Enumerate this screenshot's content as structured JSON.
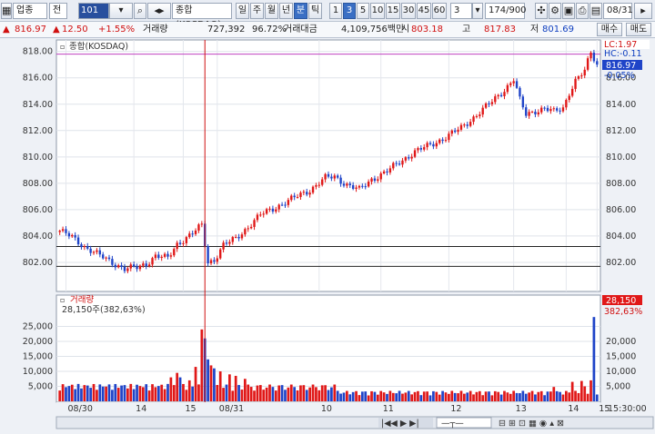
{
  "toolbar": {
    "market_select": "업종",
    "market_type": "전",
    "code": "101",
    "search_icon": "search-icon",
    "prev_next_icon": "nav-arrows-icon",
    "index_name": "종합(KOSDAQ)",
    "periods": [
      "일",
      "주",
      "월",
      "년",
      "분",
      "틱"
    ],
    "active_period": "분",
    "minutes": [
      "1",
      "3",
      "5",
      "10",
      "15",
      "30",
      "45",
      "60"
    ],
    "active_minute": "3",
    "interval_select": "3",
    "count": "174/900",
    "date": "08/31"
  },
  "quote": {
    "price": "816.97",
    "change": "12.50",
    "change_pct": "+1.55%",
    "volume_label": "거래량",
    "volume": "727,392",
    "volume_ratio": "96.72%",
    "amount_label": "거래대금",
    "amount": "4,109,756백만",
    "open_label": "시",
    "open": "803.18",
    "high_label": "고",
    "high": "817.83",
    "low_label": "저",
    "low": "801.69",
    "buy_label": "매수",
    "sell_label": "매도"
  },
  "colors": {
    "up": "#e01818",
    "down": "#1f44c8",
    "cursor": "#d01010"
  },
  "chart_data": [
    {
      "type": "candlestick",
      "title": "종합(KOSDAQ)",
      "ylim": [
        800.0,
        818.6
      ],
      "yticks": [
        "818.00",
        "816.00",
        "814.00",
        "812.00",
        "810.00",
        "808.00",
        "806.00",
        "804.00",
        "802.00"
      ],
      "xticks": [
        "08/30",
        "14",
        "15",
        "08/31",
        "10",
        "11",
        "12",
        "13",
        "14",
        "15"
      ],
      "hlines": [
        803.2,
        801.7
      ],
      "top_info": {
        "lc": "LC:1.97",
        "hc": "HC:-0.11",
        "last": "816.97",
        "last_pct": "-0.05%"
      },
      "close_anchors": [
        [
          0,
          804.4
        ],
        [
          4,
          803.9
        ],
        [
          8,
          803.2
        ],
        [
          13,
          802.5
        ],
        [
          17,
          802.0
        ],
        [
          21,
          801.5
        ],
        [
          25,
          801.6
        ],
        [
          28,
          801.9
        ],
        [
          31,
          802.5
        ],
        [
          35,
          802.3
        ],
        [
          38,
          803.4
        ],
        [
          43,
          804.2
        ],
        [
          46,
          804.8
        ],
        [
          48,
          802.0
        ],
        [
          50,
          802.2
        ],
        [
          53,
          803.3
        ],
        [
          57,
          803.8
        ],
        [
          61,
          804.7
        ],
        [
          65,
          805.6
        ],
        [
          70,
          806.2
        ],
        [
          76,
          806.9
        ],
        [
          81,
          807.5
        ],
        [
          86,
          808.4
        ],
        [
          89,
          808.5
        ],
        [
          93,
          807.9
        ],
        [
          97,
          807.5
        ],
        [
          101,
          808.3
        ],
        [
          106,
          808.9
        ],
        [
          110,
          809.6
        ],
        [
          115,
          810.4
        ],
        [
          120,
          810.9
        ],
        [
          125,
          811.5
        ],
        [
          130,
          812.2
        ],
        [
          135,
          813.2
        ],
        [
          140,
          814.2
        ],
        [
          144,
          815.1
        ],
        [
          147,
          815.9
        ],
        [
          149,
          814.3
        ],
        [
          151,
          813.2
        ],
        [
          154,
          813.5
        ],
        [
          157,
          813.7
        ],
        [
          160,
          813.4
        ],
        [
          163,
          813.7
        ],
        [
          165,
          814.9
        ],
        [
          167,
          815.8
        ],
        [
          170,
          816.5
        ],
        [
          172,
          817.9
        ],
        [
          174,
          817.0
        ]
      ]
    },
    {
      "type": "bar",
      "title": "거래량",
      "value_label": "28,150주(382,63%)",
      "ylim": [
        0,
        28500
      ],
      "yticks": [
        "25,000",
        "20,000",
        "15,000",
        "10,000",
        "5,000"
      ],
      "last_value": "28,150",
      "last_pct": "382,63%",
      "time_label": "15:30:00",
      "spike_values": [
        [
          46,
          24000
        ],
        [
          47,
          21000
        ],
        [
          48,
          14000
        ],
        [
          49,
          12000
        ],
        [
          50,
          11000
        ],
        [
          38,
          9500
        ],
        [
          39,
          8000
        ],
        [
          42,
          7000
        ],
        [
          44,
          11500
        ],
        [
          36,
          8000
        ],
        [
          52,
          10000
        ],
        [
          55,
          9000
        ],
        [
          57,
          8500
        ],
        [
          60,
          7500
        ],
        [
          173,
          28150
        ],
        [
          172,
          7000
        ],
        [
          169,
          6800
        ],
        [
          170,
          5000
        ],
        [
          166,
          6500
        ],
        [
          160,
          4800
        ]
      ]
    }
  ],
  "scroll": {
    "pointer_icon": "pointer-icon"
  }
}
